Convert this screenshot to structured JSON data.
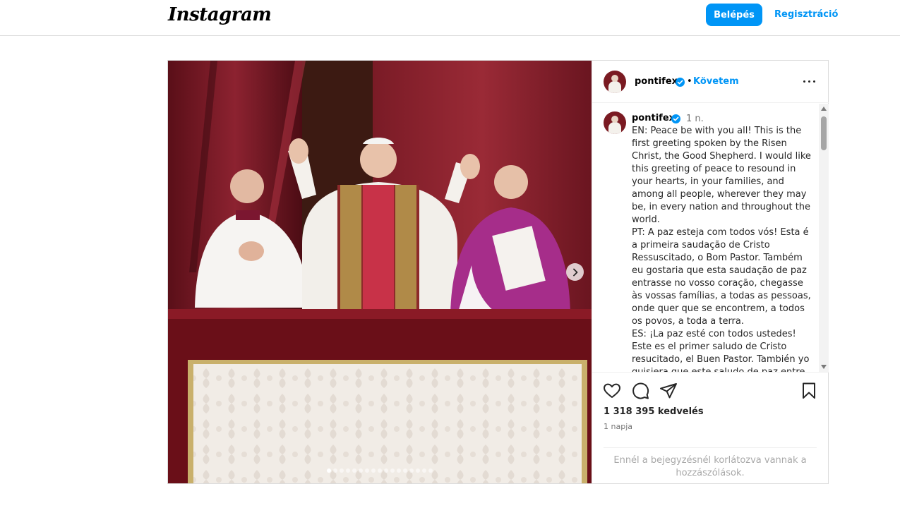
{
  "header": {
    "logo_text": "Instagram",
    "login_label": "Belépés",
    "signup_label": "Regisztráció"
  },
  "colors": {
    "accent": "#0095f6",
    "border": "#dbdbdb",
    "muted_text": "#737373"
  },
  "media": {
    "slide_count": 17,
    "active_slide": 1,
    "next_icon": "chevron-right-icon"
  },
  "post": {
    "username": "pontifex",
    "verified_icon": "verified-badge-icon",
    "separator": "•",
    "follow_label": "Követem",
    "more_icon": "more-options-icon",
    "caption": {
      "username": "pontifex",
      "time": "1 n.",
      "text": "EN: Peace be with you all! This is the first greeting spoken by the Risen Christ, the Good Shepherd. I would like this greeting of peace to resound in your hearts, in your families, and among all people, wherever they may be, in every nation and throughout the world.\nPT: A paz esteja com todos vós! Esta é a primeira saudação de Cristo Ressuscitado, o Bom Pastor. Também eu gostaria que esta saudação de paz entrasse no vosso coração, chegasse às vossas famílias, a todas as pessoas, onde quer que se encontrem, a todos os povos, a toda a terra.\nES: ¡La paz esté con todos ustedes! Este es el primer saludo de Cristo resucitado, el Buen Pastor. También yo quisiera que este saludo de paz entre en sus corazones, llegue a sus familias, a todas"
    },
    "actions": {
      "like_icon": "heart-icon",
      "comment_icon": "comment-icon",
      "share_icon": "share-icon",
      "save_icon": "bookmark-icon"
    },
    "likes": "1 318 395 kedvelés",
    "posted_ago": "1 napja",
    "comments_limited": "Ennél a bejegyzésnél korlátozva vannak a hozzászólások."
  }
}
